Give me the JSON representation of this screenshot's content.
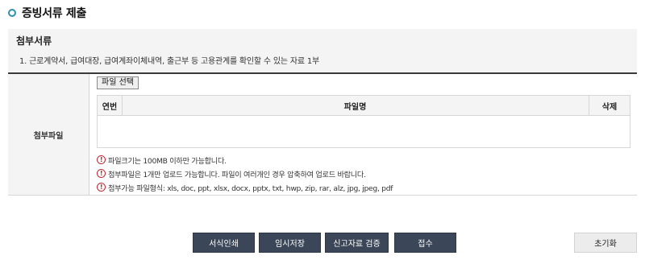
{
  "section": {
    "title": "증빙서류 제출"
  },
  "attachments_info": {
    "title": "첨부서류",
    "item": "1. 근로계약서, 급여대장, 급여계좌이체내역, 출근부 등 고용관계를 확인할 수 있는 자료 1부"
  },
  "file_upload": {
    "label": "첨부파일",
    "select_button": "파일 선택",
    "columns": {
      "no": "연번",
      "name": "파일명",
      "delete": "삭제"
    },
    "rows": [],
    "notices": [
      "파일크기는 100MB 이하만 가능합니다.",
      "첨부파일은 1개만 업로드 가능합니다. 파일이 여러개인 경우 압축하여 업로드 바랍니다.",
      "첨부가능 파일형식: xls, doc, ppt, xlsx, docx, pptx, txt, hwp, zip, rar, alz, jpg, jpeg, pdf"
    ]
  },
  "actions": {
    "print_form": "서식인쇄",
    "temp_save": "임시저장",
    "verify": "신고자료 검증",
    "submit": "접수",
    "reset": "초기화"
  },
  "colors": {
    "accent": "#2e8fb0",
    "button_dark": "#3b4758",
    "warning": "#c0272d"
  },
  "icons": {
    "title_bullet": "circle-bullet-icon",
    "notice": "exclamation-circle-icon"
  }
}
